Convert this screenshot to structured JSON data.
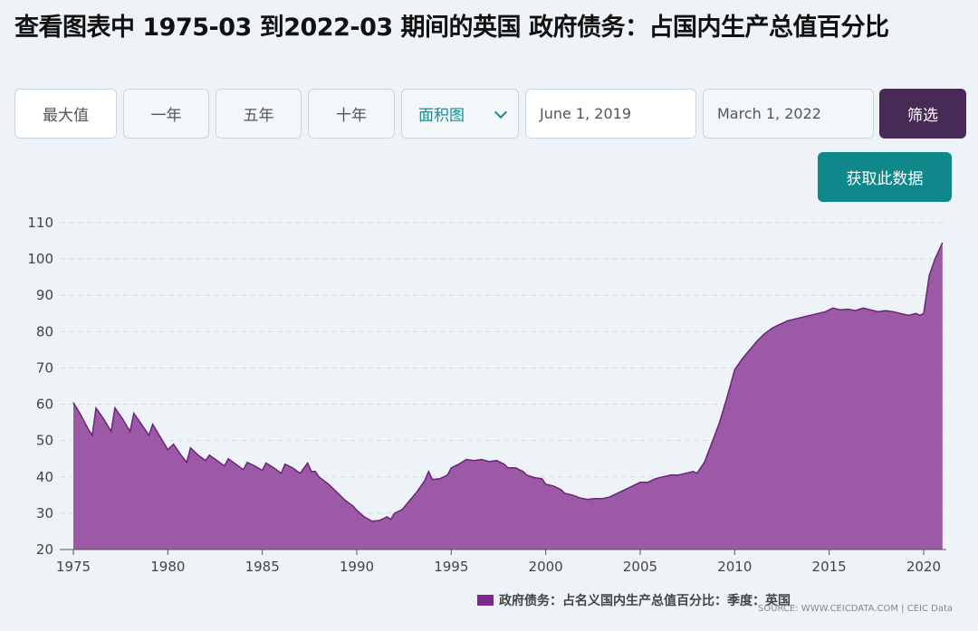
{
  "header": {
    "title": "查看图表中 1975-03 到2022-03 期间的英国 政府债务：占国内生产总值百分比"
  },
  "toolbar": {
    "max_label": "最大值",
    "one_year_label": "一年",
    "five_year_label": "五年",
    "ten_year_label": "十年",
    "chart_type_select": "面积图",
    "start_date": "June 1, 2019",
    "end_date": "March 1, 2022",
    "filter_label": "筛选",
    "get_data_label": "获取此数据"
  },
  "legend": {
    "label": "政府债务：占名义国内生产总值百分比：季度：英国"
  },
  "source": {
    "text": "SOURCE: WWW.CEICDATA.COM | CEIC Data"
  },
  "colors": {
    "area_fill": "#9c5aa6",
    "area_stroke": "#6b2478",
    "legend_swatch": "#7b2a8a",
    "accent_teal": "#10878a",
    "filter_dark": "#472a56"
  },
  "chart_data": {
    "type": "area",
    "title": "",
    "xlabel": "",
    "ylabel": "",
    "xlim": [
      1975,
      2021.2
    ],
    "ylim": [
      20,
      110
    ],
    "yticks": [
      20,
      30,
      40,
      50,
      60,
      70,
      80,
      90,
      100,
      110
    ],
    "xticks": [
      1975,
      1980,
      1985,
      1990,
      1995,
      2000,
      2005,
      2010,
      2015,
      2020
    ],
    "grid": true,
    "legend_position": "bottom-right",
    "series": [
      {
        "name": "政府债务：占名义国内生产总值百分比：季度：英国",
        "points": [
          [
            1975.0,
            60.5
          ],
          [
            1975.4,
            57.0
          ],
          [
            1975.8,
            53.0
          ],
          [
            1976.0,
            51.5
          ],
          [
            1976.2,
            59.0
          ],
          [
            1976.6,
            56.0
          ],
          [
            1977.0,
            52.5
          ],
          [
            1977.2,
            59.0
          ],
          [
            1977.6,
            56.0
          ],
          [
            1978.0,
            52.5
          ],
          [
            1978.2,
            57.5
          ],
          [
            1978.6,
            54.5
          ],
          [
            1979.0,
            51.5
          ],
          [
            1979.2,
            54.5
          ],
          [
            1979.6,
            51.0
          ],
          [
            1980.0,
            47.5
          ],
          [
            1980.3,
            49.0
          ],
          [
            1980.7,
            46.0
          ],
          [
            1981.0,
            44.0
          ],
          [
            1981.2,
            48.0
          ],
          [
            1981.6,
            46.0
          ],
          [
            1982.0,
            44.5
          ],
          [
            1982.2,
            46.0
          ],
          [
            1982.6,
            44.5
          ],
          [
            1983.0,
            43.0
          ],
          [
            1983.2,
            45.0
          ],
          [
            1983.6,
            43.5
          ],
          [
            1984.0,
            42.0
          ],
          [
            1984.2,
            44.0
          ],
          [
            1984.6,
            43.0
          ],
          [
            1985.0,
            41.8
          ],
          [
            1985.2,
            43.8
          ],
          [
            1985.6,
            42.5
          ],
          [
            1986.0,
            41.0
          ],
          [
            1986.2,
            43.5
          ],
          [
            1986.6,
            42.5
          ],
          [
            1987.0,
            41.0
          ],
          [
            1987.4,
            43.8
          ],
          [
            1987.6,
            41.5
          ],
          [
            1987.8,
            41.5
          ],
          [
            1988.0,
            40.0
          ],
          [
            1988.5,
            38.0
          ],
          [
            1989.0,
            35.5
          ],
          [
            1989.4,
            33.5
          ],
          [
            1989.8,
            32.0
          ],
          [
            1990.0,
            30.8
          ],
          [
            1990.4,
            29.0
          ],
          [
            1990.8,
            27.8
          ],
          [
            1991.2,
            28.0
          ],
          [
            1991.6,
            29.0
          ],
          [
            1991.8,
            28.3
          ],
          [
            1992.0,
            30.0
          ],
          [
            1992.4,
            31.0
          ],
          [
            1992.8,
            33.5
          ],
          [
            1993.2,
            36.0
          ],
          [
            1993.6,
            39.0
          ],
          [
            1993.8,
            41.5
          ],
          [
            1994.0,
            39.3
          ],
          [
            1994.4,
            39.5
          ],
          [
            1994.8,
            40.5
          ],
          [
            1995.0,
            42.5
          ],
          [
            1995.4,
            43.5
          ],
          [
            1995.8,
            44.8
          ],
          [
            1996.2,
            44.5
          ],
          [
            1996.6,
            44.8
          ],
          [
            1997.0,
            44.2
          ],
          [
            1997.4,
            44.5
          ],
          [
            1997.8,
            43.5
          ],
          [
            1998.0,
            42.5
          ],
          [
            1998.4,
            42.5
          ],
          [
            1998.8,
            41.5
          ],
          [
            1999.0,
            40.5
          ],
          [
            1999.4,
            39.8
          ],
          [
            1999.8,
            39.5
          ],
          [
            2000.0,
            38.0
          ],
          [
            2000.4,
            37.5
          ],
          [
            2000.8,
            36.5
          ],
          [
            2001.0,
            35.5
          ],
          [
            2001.4,
            35.0
          ],
          [
            2001.8,
            34.2
          ],
          [
            2002.2,
            33.8
          ],
          [
            2002.6,
            34.0
          ],
          [
            2003.0,
            34.0
          ],
          [
            2003.4,
            34.5
          ],
          [
            2003.8,
            35.5
          ],
          [
            2004.2,
            36.5
          ],
          [
            2004.6,
            37.5
          ],
          [
            2005.0,
            38.5
          ],
          [
            2005.4,
            38.5
          ],
          [
            2005.8,
            39.5
          ],
          [
            2006.2,
            40.0
          ],
          [
            2006.6,
            40.5
          ],
          [
            2007.0,
            40.5
          ],
          [
            2007.4,
            41.0
          ],
          [
            2007.8,
            41.5
          ],
          [
            2008.0,
            41.0
          ],
          [
            2008.4,
            44.0
          ],
          [
            2008.8,
            49.5
          ],
          [
            2009.2,
            55.0
          ],
          [
            2009.6,
            62.0
          ],
          [
            2010.0,
            69.5
          ],
          [
            2010.4,
            72.5
          ],
          [
            2010.8,
            75.0
          ],
          [
            2011.2,
            77.5
          ],
          [
            2011.6,
            79.5
          ],
          [
            2012.0,
            81.0
          ],
          [
            2012.4,
            82.0
          ],
          [
            2012.8,
            83.0
          ],
          [
            2013.2,
            83.5
          ],
          [
            2013.6,
            84.0
          ],
          [
            2014.0,
            84.5
          ],
          [
            2014.4,
            85.0
          ],
          [
            2014.8,
            85.5
          ],
          [
            2015.2,
            86.5
          ],
          [
            2015.6,
            86.0
          ],
          [
            2016.0,
            86.2
          ],
          [
            2016.4,
            85.8
          ],
          [
            2016.8,
            86.5
          ],
          [
            2017.2,
            86.0
          ],
          [
            2017.6,
            85.5
          ],
          [
            2018.0,
            85.8
          ],
          [
            2018.4,
            85.5
          ],
          [
            2018.8,
            85.0
          ],
          [
            2019.2,
            84.5
          ],
          [
            2019.6,
            85.0
          ],
          [
            2019.8,
            84.5
          ],
          [
            2020.0,
            85.0
          ],
          [
            2020.3,
            95.5
          ],
          [
            2020.6,
            100.0
          ],
          [
            2021.0,
            104.5
          ]
        ]
      }
    ]
  }
}
